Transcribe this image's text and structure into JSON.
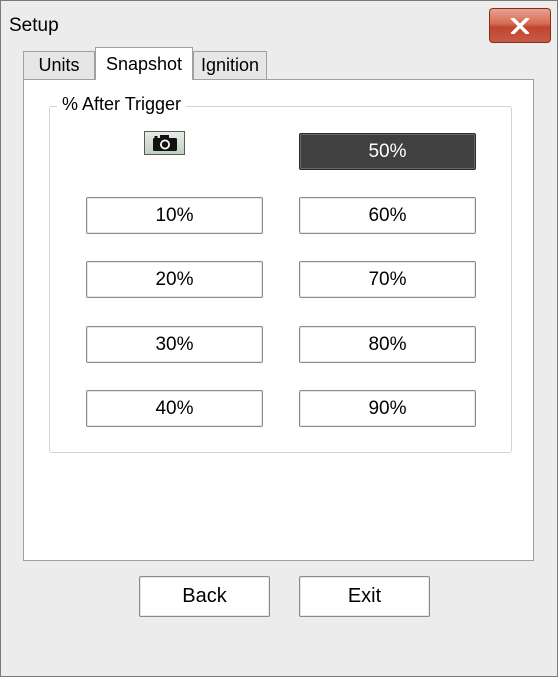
{
  "window": {
    "title": "Setup",
    "close_icon": "close-icon"
  },
  "tabs": [
    {
      "label": "Units",
      "active": false
    },
    {
      "label": "Snapshot",
      "active": true
    },
    {
      "label": "Ignition",
      "active": false
    }
  ],
  "snapshot": {
    "group_label": "% After Trigger",
    "camera_icon": "camera-icon",
    "selected": "50%",
    "options_left": [
      "10%",
      "20%",
      "30%",
      "40%"
    ],
    "options_right": [
      "50%",
      "60%",
      "70%",
      "80%",
      "90%"
    ]
  },
  "footer": {
    "back_label": "Back",
    "exit_label": "Exit"
  },
  "colors": {
    "close_button": "#c75a44",
    "selected_button": "#404040",
    "camera_icon_bg": "#bfcfc0"
  }
}
